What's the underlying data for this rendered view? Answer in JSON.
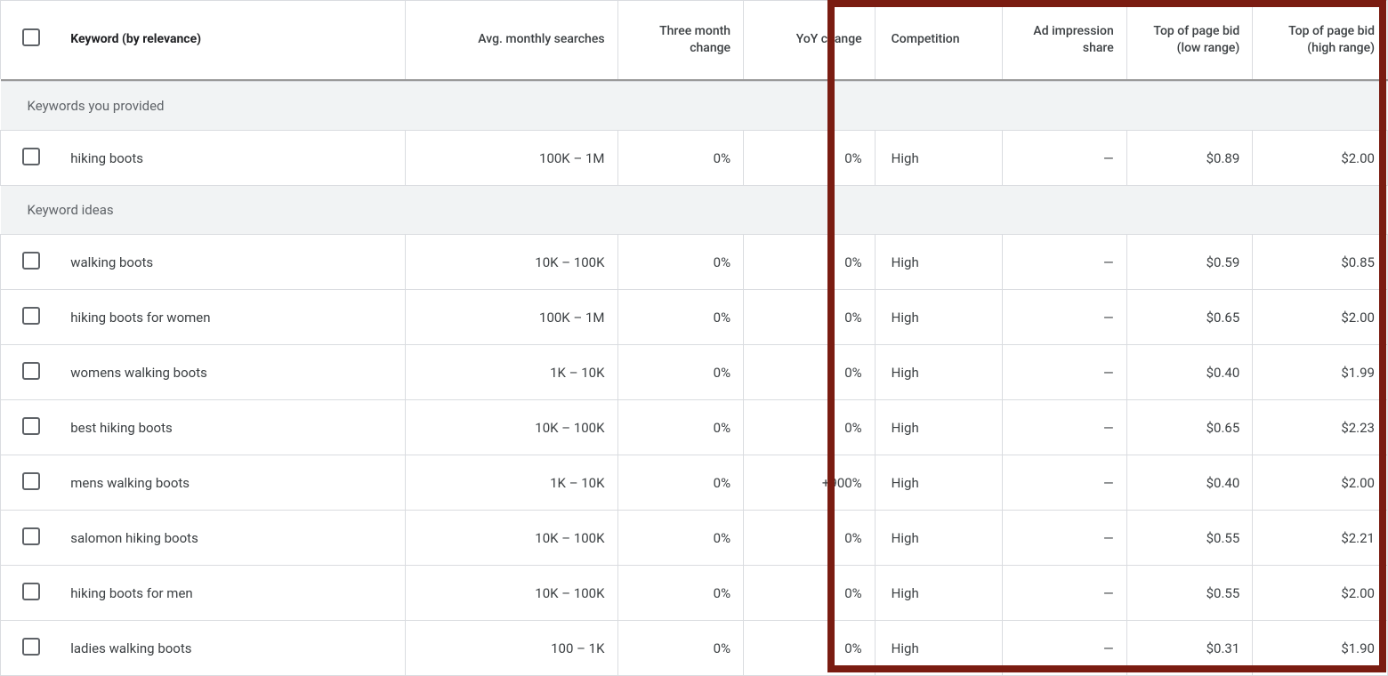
{
  "columns": {
    "keyword": "Keyword (by relevance)",
    "searches": "Avg. monthly searches",
    "threeMonth": "Three month change",
    "yoy": "YoY change",
    "competition": "Competition",
    "impressionShare": "Ad impression share",
    "bidLow": "Top of page bid (low range)",
    "bidHigh": "Top of page bid (high range)"
  },
  "sections": {
    "provided": "Keywords you provided",
    "ideas": "Keyword ideas"
  },
  "rowsProvided": [
    {
      "keyword": "hiking boots",
      "searches": "100K – 1M",
      "threeMonth": "0%",
      "yoy": "0%",
      "competition": "High",
      "impressionShare": "—",
      "bidLow": "$0.89",
      "bidHigh": "$2.00"
    }
  ],
  "rowsIdeas": [
    {
      "keyword": "walking boots",
      "searches": "10K – 100K",
      "threeMonth": "0%",
      "yoy": "0%",
      "competition": "High",
      "impressionShare": "—",
      "bidLow": "$0.59",
      "bidHigh": "$0.85"
    },
    {
      "keyword": "hiking boots for women",
      "searches": "100K – 1M",
      "threeMonth": "0%",
      "yoy": "0%",
      "competition": "High",
      "impressionShare": "—",
      "bidLow": "$0.65",
      "bidHigh": "$2.00"
    },
    {
      "keyword": "womens walking boots",
      "searches": "1K – 10K",
      "threeMonth": "0%",
      "yoy": "0%",
      "competition": "High",
      "impressionShare": "—",
      "bidLow": "$0.40",
      "bidHigh": "$1.99"
    },
    {
      "keyword": "best hiking boots",
      "searches": "10K – 100K",
      "threeMonth": "0%",
      "yoy": "0%",
      "competition": "High",
      "impressionShare": "—",
      "bidLow": "$0.65",
      "bidHigh": "$2.23"
    },
    {
      "keyword": "mens walking boots",
      "searches": "1K – 10K",
      "threeMonth": "0%",
      "yoy": "+900%",
      "competition": "High",
      "impressionShare": "—",
      "bidLow": "$0.40",
      "bidHigh": "$2.00"
    },
    {
      "keyword": "salomon hiking boots",
      "searches": "10K – 100K",
      "threeMonth": "0%",
      "yoy": "0%",
      "competition": "High",
      "impressionShare": "—",
      "bidLow": "$0.55",
      "bidHigh": "$2.21"
    },
    {
      "keyword": "hiking boots for men",
      "searches": "10K – 100K",
      "threeMonth": "0%",
      "yoy": "0%",
      "competition": "High",
      "impressionShare": "—",
      "bidLow": "$0.55",
      "bidHigh": "$2.00"
    },
    {
      "keyword": "ladies walking boots",
      "searches": "100 – 1K",
      "threeMonth": "0%",
      "yoy": "0%",
      "competition": "High",
      "impressionShare": "—",
      "bidLow": "$0.31",
      "bidHigh": "$1.90"
    }
  ]
}
